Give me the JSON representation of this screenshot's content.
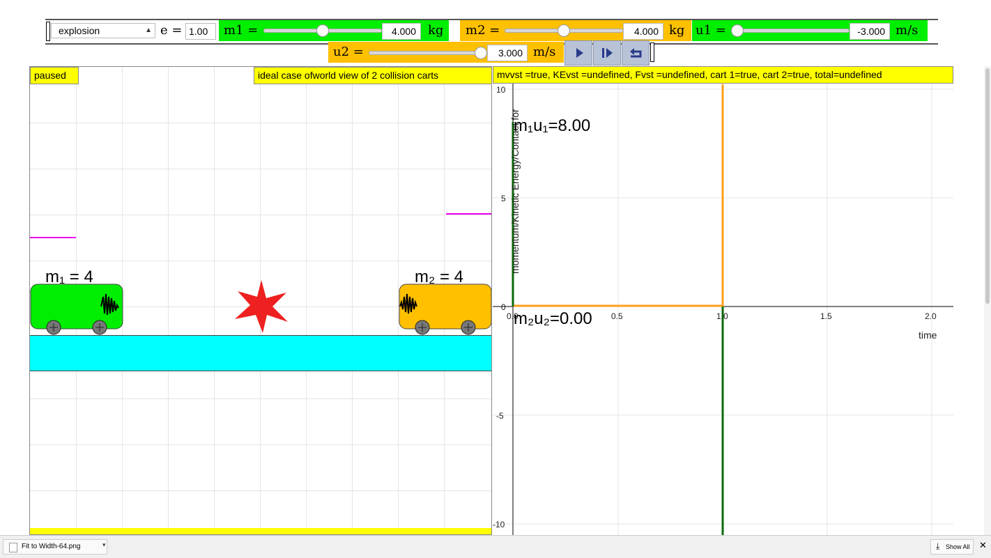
{
  "toolbar": {
    "scenario_select": "explosion",
    "e_label": "e =",
    "e_value": "1.00",
    "m1_label": "m1 =",
    "m1_value": "4.000",
    "m1_slider_fraction": 0.5,
    "m1_unit": "kg",
    "m2_label": "m2 =",
    "m2_value": "4.000",
    "m2_slider_fraction": 0.5,
    "m2_unit": "kg",
    "u1_label": "u1 =",
    "u1_value": "-3.000",
    "u1_slider_fraction": 0.0,
    "u1_unit": "m/s",
    "u2_label": "u2 =",
    "u2_value": "3.000",
    "u2_slider_fraction": 1.0,
    "u2_unit": "m/s",
    "buttons": [
      "play-icon",
      "step-icon",
      "reset-icon"
    ]
  },
  "world": {
    "status": "paused",
    "title": "ideal case ofworld view of 2 collision carts",
    "cart1_label": "m₁ = 4",
    "cart2_label": "m₂ = 4"
  },
  "graph": {
    "header": "mvvst =true, KEvst =undefined, Fvst =undefined, cart 1=true, cart 2=true, total=undefined",
    "ylabel": "momentum/Kinetic Energy/Contact for",
    "xlabel": "time",
    "annotation1": "m₁u₁=8.00",
    "annotation2": "m₂u₂=0.00",
    "xticks": [
      "0.0",
      "0.5",
      "1.0",
      "1.5",
      "2.0"
    ],
    "yticks": [
      "10",
      "5",
      "0",
      "-5",
      "-10"
    ]
  },
  "footer": {
    "download_name": "Fit to Width-64.png",
    "show_all": "Show All"
  },
  "colors": {
    "green": "#00ee00",
    "orange": "#ffc000",
    "yellow": "#ffff00",
    "cyan": "#00ffff",
    "magenta": "#ee00ee",
    "button": "#b9c3d8"
  }
}
